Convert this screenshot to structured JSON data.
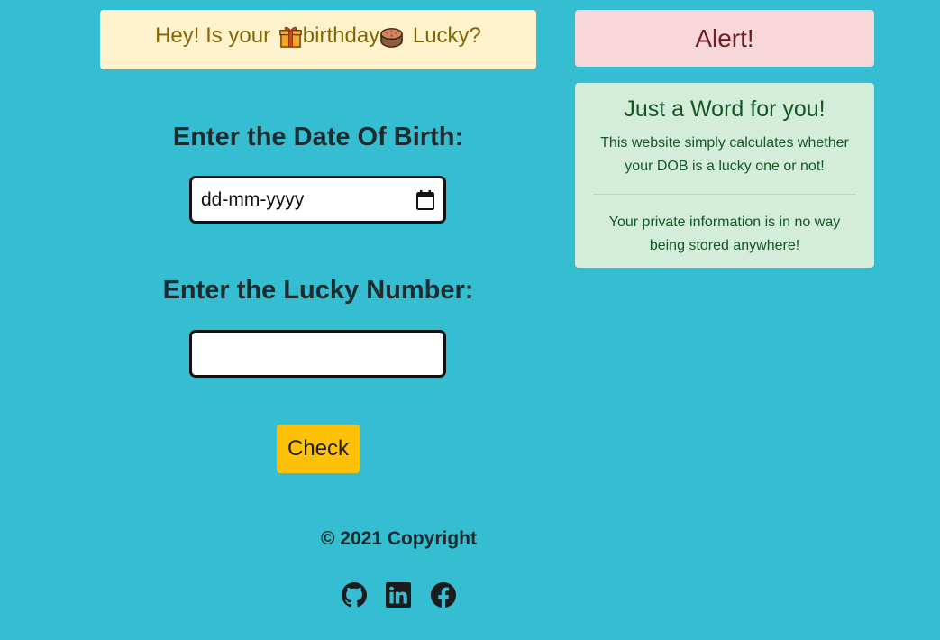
{
  "banner": {
    "prefix": "Hey! Is your ",
    "word": "birthday",
    "suffix": " Lucky?",
    "gift_icon": "gift-icon",
    "cake_icon": "birthday-cake-icon"
  },
  "alert": {
    "text": "Alert!"
  },
  "info": {
    "title": "Just a Word for you!",
    "line1": "This website simply calculates whether your DOB is a lucky one or not!",
    "line2": "Your private information is in no way being stored anywhere!"
  },
  "form": {
    "dob_label": "Enter the Date Of Birth:",
    "dob_placeholder": "dd-mm-yyyy",
    "lucky_label": "Enter the Lucky Number:",
    "lucky_value": "",
    "check_label": "Check"
  },
  "footer": {
    "copyright": "© 2021 Copyright",
    "icons": [
      "github-icon",
      "linkedin-icon",
      "facebook-icon"
    ]
  },
  "colors": {
    "background": "#35bdd1",
    "banner_bg": "#fff3cd",
    "alert_bg": "#f8d7da",
    "info_bg": "#d4edda",
    "button_bg": "#ffc107"
  }
}
